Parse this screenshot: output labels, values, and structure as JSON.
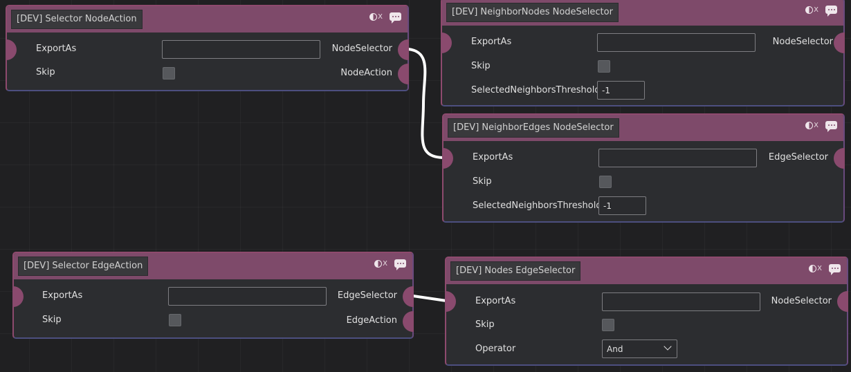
{
  "nodes": {
    "selector_node_action": {
      "title": "[DEV] Selector NodeAction",
      "export_label": "ExportAs",
      "export_value": "",
      "skip_label": "Skip",
      "outputs": [
        "NodeSelector",
        "NodeAction"
      ]
    },
    "neighbor_nodes": {
      "title": "[DEV] NeighborNodes NodeSelector",
      "export_label": "ExportAs",
      "export_value": "",
      "skip_label": "Skip",
      "threshold_label": "SelectedNeighborsThreshold",
      "threshold_value": "-1",
      "outputs": [
        "NodeSelector"
      ]
    },
    "neighbor_edges": {
      "title": "[DEV] NeighborEdges NodeSelector",
      "export_label": "ExportAs",
      "export_value": "",
      "skip_label": "Skip",
      "threshold_label": "SelectedNeighborsThreshold",
      "threshold_value": "-1",
      "outputs": [
        "EdgeSelector"
      ]
    },
    "selector_edge_action": {
      "title": "[DEV] Selector EdgeAction",
      "export_label": "ExportAs",
      "export_value": "",
      "skip_label": "Skip",
      "outputs": [
        "EdgeSelector",
        "EdgeAction"
      ]
    },
    "nodes_edge_selector": {
      "title": "[DEV] Nodes EdgeSelector",
      "export_label": "ExportAs",
      "export_value": "",
      "skip_label": "Skip",
      "operator_label": "Operator",
      "operator_value": "And",
      "outputs": [
        "NodeSelector"
      ]
    }
  },
  "header_icons": {
    "toggle": "toggle-enable-icon",
    "toggle_glyph": "X",
    "comment": "comment-icon"
  },
  "colors": {
    "background": "#202022",
    "node_body": "#2c2d30",
    "node_header": "#7e4a6a",
    "port": "#8a4a6e",
    "wire": "#ffffff"
  }
}
